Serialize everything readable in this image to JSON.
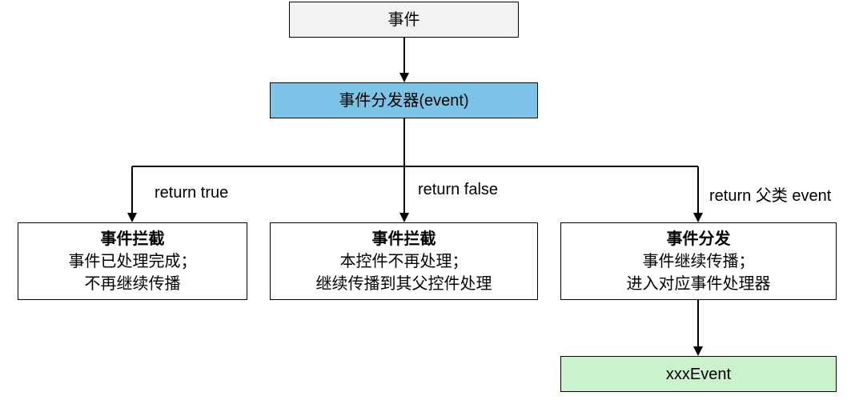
{
  "nodes": {
    "event": "事件",
    "dispatcher": "事件分发器(event)",
    "intercept_true": {
      "title": "事件拦截",
      "line1": "事件已处理完成；",
      "line2": "不再继续传播"
    },
    "intercept_false": {
      "title": "事件拦截",
      "line1": "本控件不再处理；",
      "line2": "继续传播到其父控件处理"
    },
    "dispatch_parent": {
      "title": "事件分发",
      "line1": "事件继续传播；",
      "line2": "进入对应事件处理器"
    },
    "handler": "xxxEvent"
  },
  "edges": {
    "left": "return true",
    "middle": "return false",
    "right": "return 父类 event"
  }
}
